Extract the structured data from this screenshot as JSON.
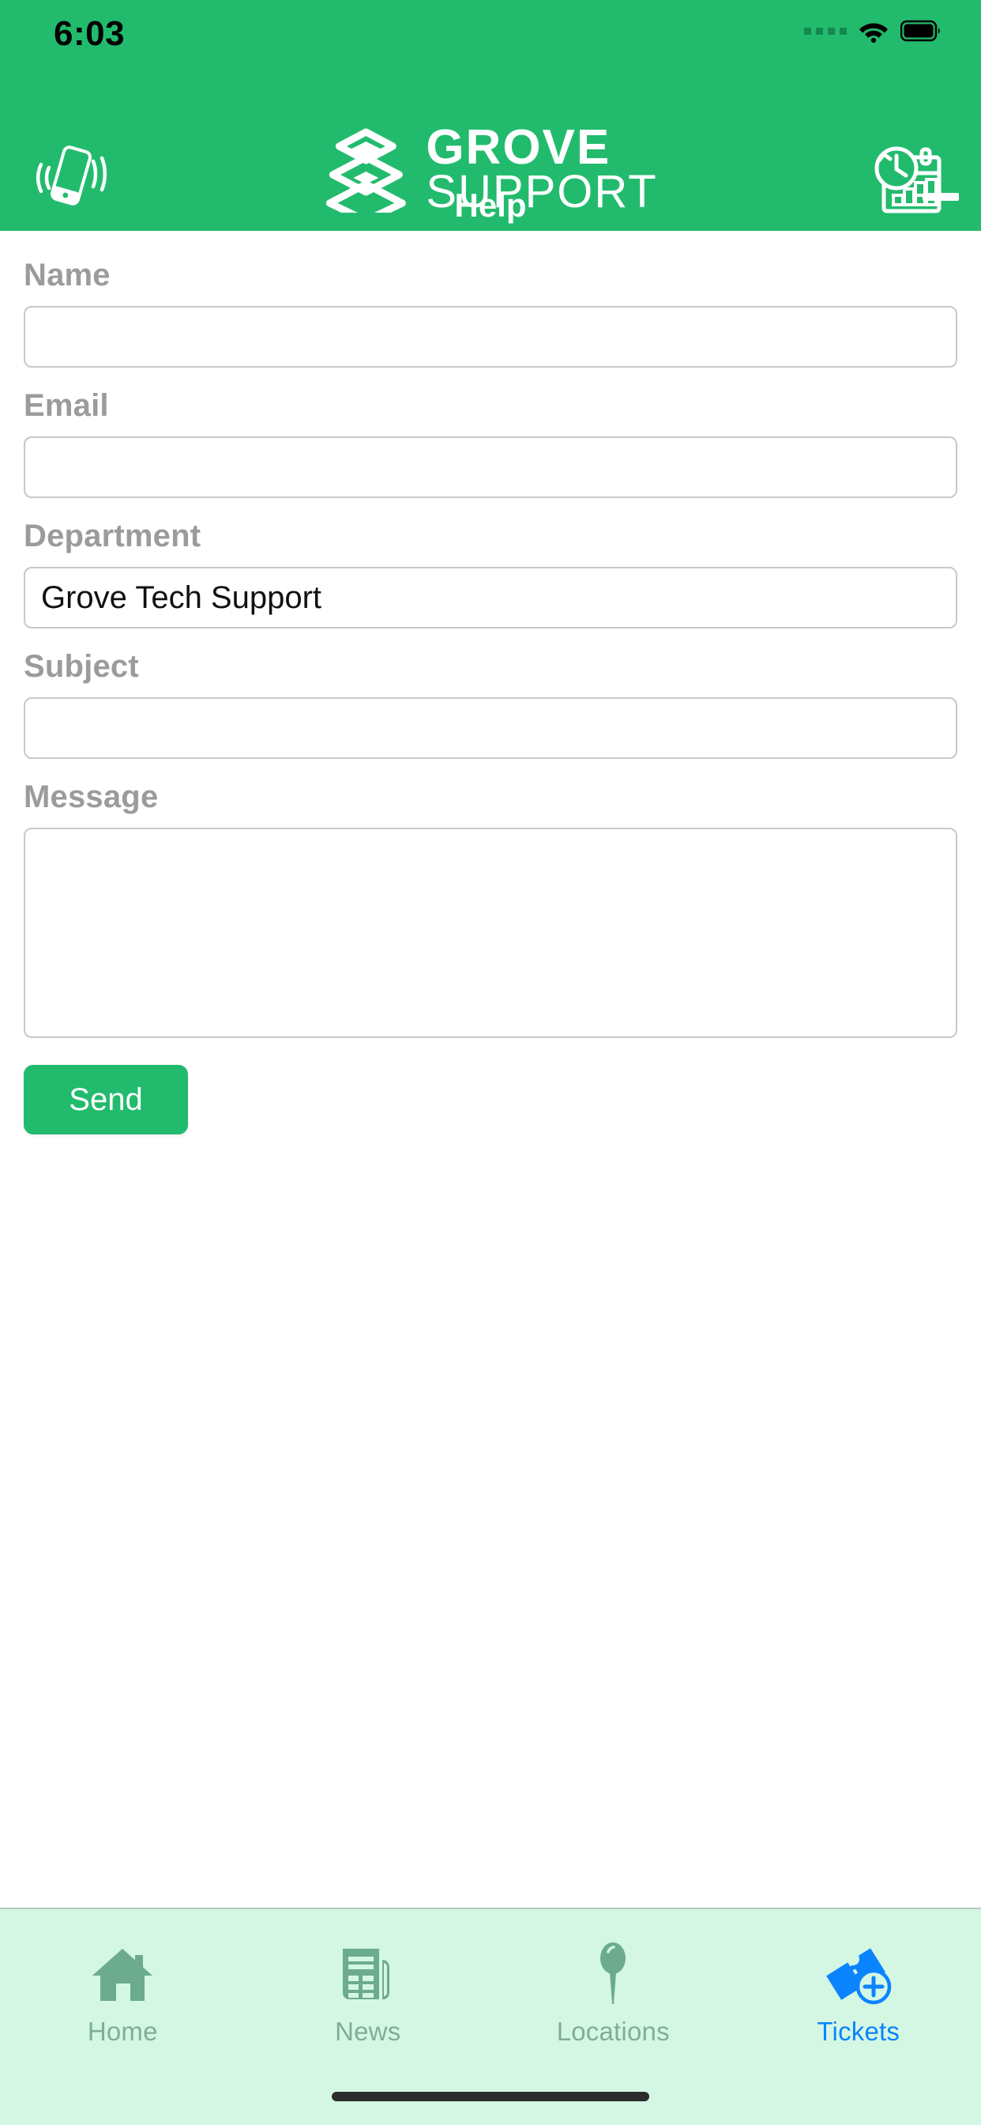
{
  "status_bar": {
    "time": "6:03",
    "signal_icon": "signal-dots-icon",
    "wifi_icon": "wifi-icon",
    "battery_icon": "battery-full-icon"
  },
  "header": {
    "background_color": "#22bb6d",
    "phone_button_icon": "vibrating-phone-icon",
    "history_button_icon": "calendar-clock-icon",
    "brand": {
      "mark_icon": "grove-stack-logo-icon",
      "line1": "GROVE",
      "line2": "SUPPORT"
    },
    "panel_title": "Help",
    "minimize_icon": "minimize-dash-icon"
  },
  "form": {
    "fields": [
      {
        "label": "Name",
        "value": "",
        "placeholder": "",
        "type": "text"
      },
      {
        "label": "Email",
        "value": "",
        "placeholder": "",
        "type": "text"
      },
      {
        "label": "Department",
        "value": "Grove Tech Support",
        "placeholder": "",
        "type": "text"
      },
      {
        "label": "Subject",
        "value": "",
        "placeholder": "",
        "type": "text"
      },
      {
        "label": "Message",
        "value": "",
        "placeholder": "",
        "type": "textarea"
      }
    ],
    "submit_label": "Send",
    "submit_color": "#22bb6d"
  },
  "tabbar": {
    "background_color": "#d4f7e3",
    "inactive_color": "#7fae96",
    "active_color": "#0a84ff",
    "items": [
      {
        "label": "Home",
        "icon": "house-icon",
        "active": false
      },
      {
        "label": "News",
        "icon": "newspaper-icon",
        "active": false
      },
      {
        "label": "Locations",
        "icon": "map-pin-icon",
        "active": false
      },
      {
        "label": "Tickets",
        "icon": "ticket-plus-icon",
        "active": true
      }
    ],
    "home_indicator": "home-indicator"
  }
}
